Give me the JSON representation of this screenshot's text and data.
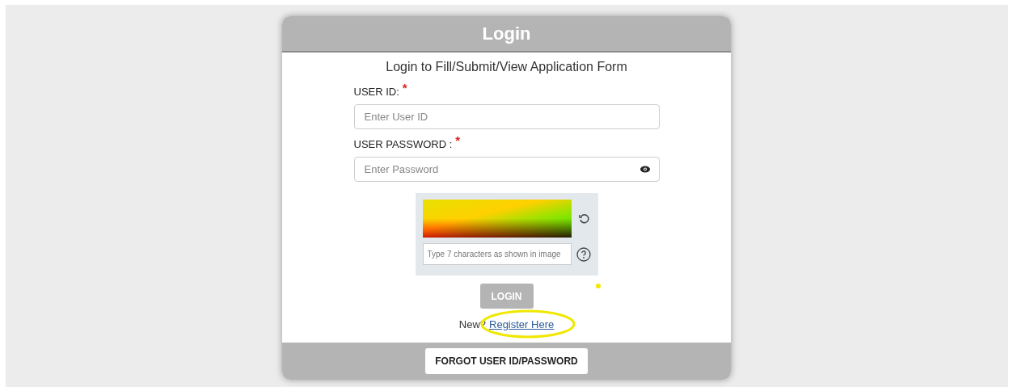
{
  "card": {
    "title": "Login",
    "subtitle": "Login to Fill/Submit/View Application Form"
  },
  "fields": [
    {
      "label": "USER ID:",
      "required_mark": "*",
      "placeholder": "Enter User ID",
      "kind": "text"
    },
    {
      "label": "USER PASSWORD :",
      "required_mark": "*",
      "placeholder": "Enter Password",
      "kind": "password"
    }
  ],
  "captcha": {
    "placeholder": "Type 7 characters as shown in image"
  },
  "login_button": {
    "label": "LOGIN",
    "disabled": true
  },
  "register": {
    "prompt": "New?",
    "link": "Register Here"
  },
  "forgot_button": {
    "label": "FORGOT USER ID/PASSWORD"
  }
}
